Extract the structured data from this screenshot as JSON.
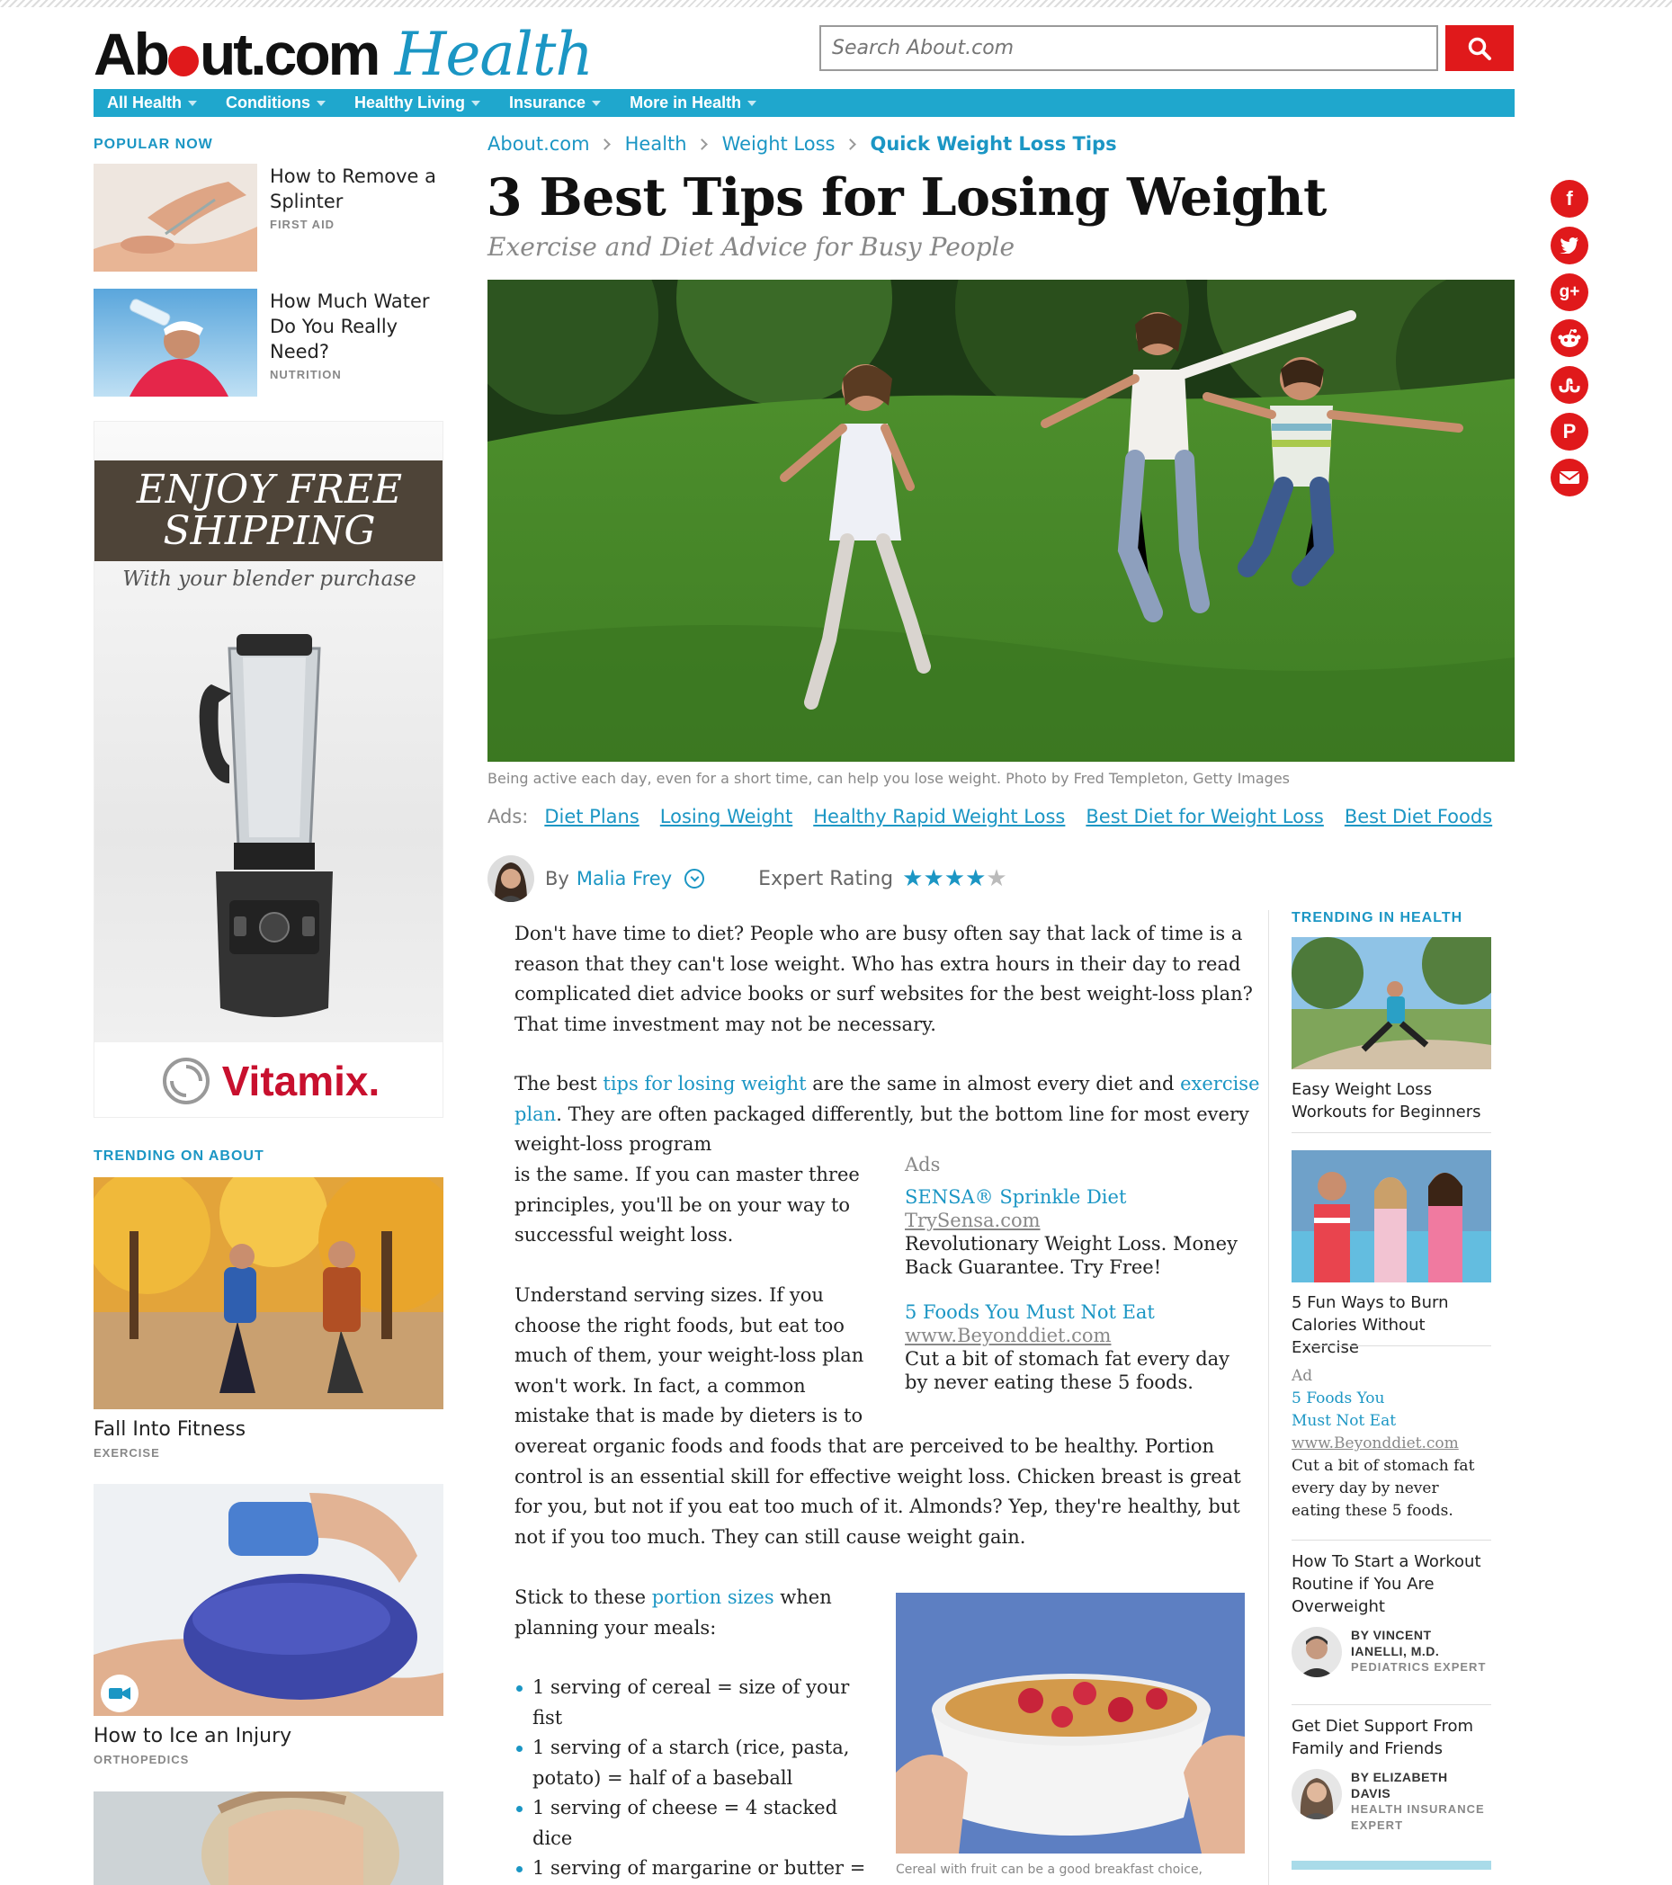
{
  "header": {
    "logo_about": "About",
    "logo_com": ".com",
    "logo_health": "Health",
    "search_placeholder": "Search About.com",
    "search_icon": "magnifier-icon"
  },
  "nav": [
    {
      "label": "All Health"
    },
    {
      "label": "Conditions"
    },
    {
      "label": "Healthy Living"
    },
    {
      "label": "Insurance"
    },
    {
      "label": "More in Health"
    }
  ],
  "popular": {
    "heading": "POPULAR NOW",
    "items": [
      {
        "title": "How to Remove a Splinter",
        "category": "FIRST AID"
      },
      {
        "title": "How Much Water Do You Really Need?",
        "category": "NUTRITION"
      }
    ]
  },
  "ad_vitamix": {
    "line1": "ENJOY FREE",
    "line2": "SHIPPING",
    "sub": "With your blender purchase",
    "brand": "Vitamix."
  },
  "trending_about": {
    "heading": "TRENDING ON ABOUT",
    "items": [
      {
        "title": "Fall Into Fitness",
        "category": "EXERCISE"
      },
      {
        "title": "How to Ice an Injury",
        "category": "ORTHOPEDICS"
      }
    ]
  },
  "breadcrumb": [
    "About.com",
    "Health",
    "Weight Loss",
    "Quick Weight Loss Tips"
  ],
  "article": {
    "title": "3 Best Tips for Losing Weight",
    "subtitle": "Exercise and Diet Advice for Busy People",
    "caption": "Being active each day, even for a short time, can help you lose weight. Photo by Fred Templeton, Getty Images",
    "ads_label": "Ads:",
    "ad_links": [
      "Diet Plans",
      "Losing Weight",
      "Healthy Rapid Weight Loss",
      "Best Diet for Weight Loss",
      "Best Diet Foods"
    ],
    "author_by": "By",
    "author_name": "Malia Frey",
    "rating_label": "Expert Rating",
    "rating": 4,
    "rating_max": 5,
    "p1": "Don't have time to diet? People who are busy often say that lack of time is a reason that they can't lose weight. Who has extra hours in their day to read complicated diet advice books or surf websites for the best weight-loss plan? That time investment may not be necessary.",
    "p2_a": "The best ",
    "p2_link1": "tips for losing weight",
    "p2_b": " are the same in almost every diet and ",
    "p2_link2": "exercise plan",
    "p2_c": ". They are often packaged differently, but the bottom line for most every weight-loss program",
    "p2_d": "is the same. If you can master three principles, you'll be on your way to successful weight loss.",
    "p3_a": "Understand serving sizes. If you choose the right foods, but eat too much of them, your weight-loss plan won't work. In fact, a common mistake that is made by dieters is to",
    "p3_b": "overeat organic foods and foods that are perceived to be healthy. Portion control is an essential skill for effective weight loss. Chicken breast is great for you, but not if you eat too much of it. Almonds? Yep, they're healthy, but not if you too much. They can still cause weight gain.",
    "p4_a": "Stick to these ",
    "p4_link": "portion sizes",
    "p4_b": " when planning your meals:",
    "list": [
      "1 serving of cereal = size of your fist",
      "1 serving of a starch (rice, pasta, potato) = half of a baseball",
      "1 serving of cheese = 4 stacked dice",
      "1 serving of margarine or butter ="
    ],
    "cereal_caption": "Cereal with fruit can be a good breakfast choice,"
  },
  "inline_ads": {
    "label": "Ads",
    "items": [
      {
        "headline": "SENSA® Sprinkle Diet",
        "url": "TrySensa.com",
        "desc": "Revolutionary Weight Loss. Money Back Guarantee. Try Free!"
      },
      {
        "headline": "5 Foods You Must Not Eat",
        "url": "www.Beyonddiet.com",
        "desc": "Cut a bit of stomach fat every day by never eating these 5 foods."
      }
    ]
  },
  "sidebar": {
    "heading": "TRENDING IN HEALTH",
    "cards": [
      {
        "title": "Easy Weight Loss Workouts for Beginners"
      },
      {
        "title": "5 Fun Ways to Burn Calories Without Exercise"
      }
    ],
    "ad": {
      "label": "Ad",
      "headline_1": "5 Foods You",
      "headline_2": "Must Not Eat",
      "url": "www.Beyonddiet.com",
      "desc": "Cut a bit of stomach fat every day by never eating these  5 foods."
    },
    "experts": [
      {
        "title": "How To Start a Workout Routine if You Are Overweight",
        "by": "BY VINCENT IANELLI, M.D.",
        "role": "PEDIATRICS EXPERT"
      },
      {
        "title": "Get Diet Support From Family and Friends",
        "by": "BY ELIZABETH DAVIS",
        "role": "HEALTH INSURANCE EXPERT"
      }
    ]
  },
  "social": [
    "facebook-icon",
    "twitter-icon",
    "googleplus-icon",
    "reddit-icon",
    "stumbleupon-icon",
    "pinterest-icon",
    "email-icon"
  ],
  "colors": {
    "brand_red": "#e0191b",
    "brand_blue": "#1b96c4",
    "nav_blue": "#1fa7cd"
  }
}
